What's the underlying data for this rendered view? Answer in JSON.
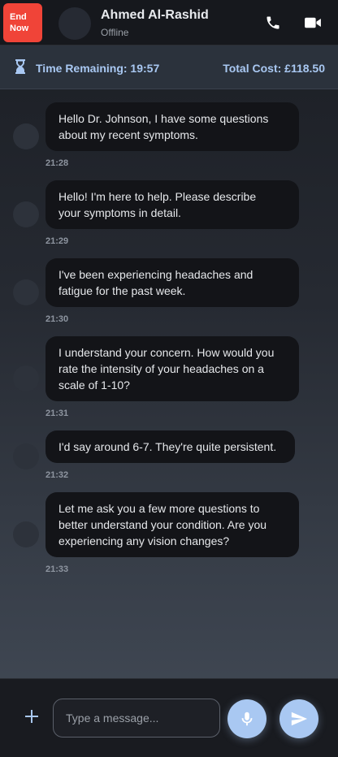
{
  "header": {
    "end_button_line1": "End",
    "end_button_line2": "Now",
    "contact_name": "Ahmed Al-Rashid",
    "contact_status": "Offline",
    "call_icon": "phone-icon",
    "video_icon": "video-camera-icon"
  },
  "session": {
    "time_remaining": "Time Remaining: 19:57",
    "total_cost": "Total Cost: £118.50",
    "timer_icon": "hourglass-icon",
    "accent_color": "#a9c8f2"
  },
  "messages": [
    {
      "text": "Hello Dr. Johnson, I have some questions\nabout my recent symptoms.",
      "time": "21:28"
    },
    {
      "text": "Hello! I'm here to help. Please describe\nyour symptoms in detail.",
      "time": "21:29"
    },
    {
      "text": "I've been experiencing headaches and\nfatigue for the past week.",
      "time": "21:30"
    },
    {
      "text": "I understand your concern. How would you\nrate the intensity of your headaches on a\nscale of 1-10?",
      "time": "21:31"
    },
    {
      "text": "I'd say around 6-7. They're quite persistent.",
      "time": "21:32"
    },
    {
      "text": "Let me ask you a few more questions to\nbetter understand your condition. Are you\nexperiencing any vision changes?",
      "time": "21:33"
    }
  ],
  "composer": {
    "placeholder": "Type a message...",
    "value": "",
    "attach_icon": "plus-icon",
    "mic_icon": "microphone-icon",
    "send_icon": "send-icon"
  },
  "colors": {
    "end_button": "#f04438",
    "bubble_bg": "#131418"
  }
}
